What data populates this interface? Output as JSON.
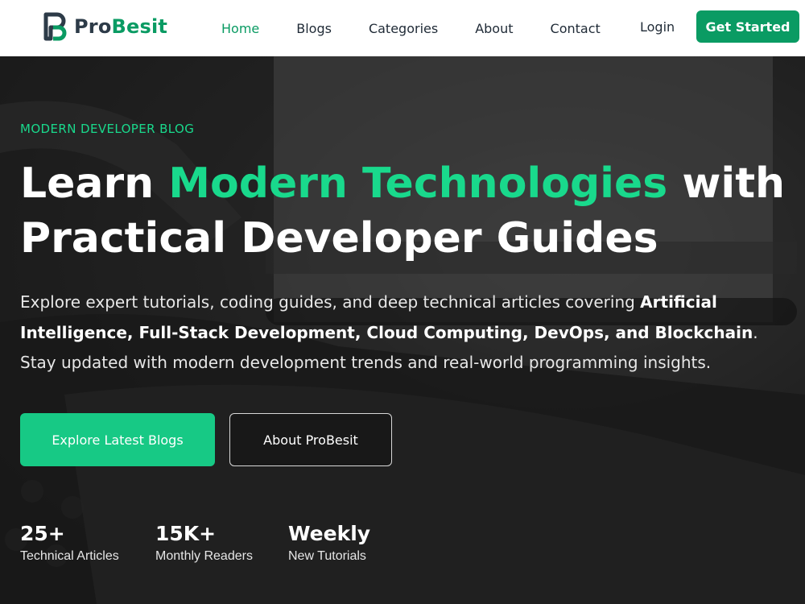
{
  "brand": {
    "name_part1": "Pro",
    "name_part2": "Besit",
    "accent_color": "#0a9b63",
    "logo_icon": "pb-monogram-icon"
  },
  "nav": {
    "items": [
      {
        "label": "Home",
        "active": true
      },
      {
        "label": "Blogs",
        "active": false
      },
      {
        "label": "Categories",
        "active": false
      },
      {
        "label": "About",
        "active": false
      },
      {
        "label": "Contact",
        "active": false
      }
    ],
    "login_label": "Login",
    "cta_label": "Get Started"
  },
  "hero": {
    "eyebrow": "MODERN DEVELOPER BLOG",
    "headline_pre": "Learn ",
    "headline_highlight": "Modern Technologies",
    "headline_post": " with Practical Developer Guides",
    "subtext_pre": "Explore expert tutorials, coding guides, and deep technical articles covering ",
    "subtext_bold": "Artificial Intelligence, Full-Stack Development, Cloud Computing, DevOps, and Blockchain",
    "subtext_post": ". Stay updated with modern development trends and real-world programming insights.",
    "primary_button": "Explore Latest Blogs",
    "secondary_button": "About ProBesit",
    "highlight_color": "#19d98c",
    "background_image": "typewriter-photo"
  },
  "stats": [
    {
      "value": "25+",
      "label": "Technical Articles"
    },
    {
      "value": "15K+",
      "label": "Monthly Readers"
    },
    {
      "value": "Weekly",
      "label": "New Tutorials"
    }
  ]
}
